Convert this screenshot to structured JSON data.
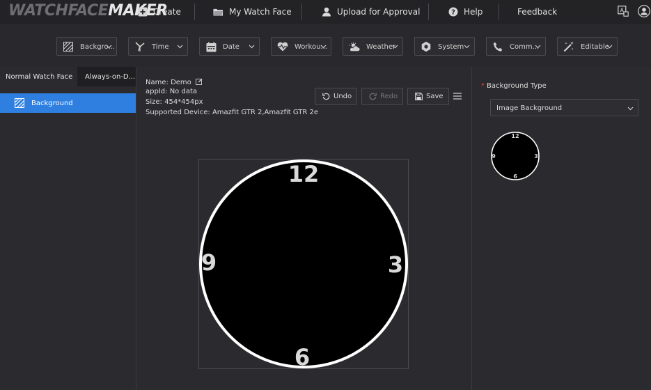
{
  "app": {
    "logo_part1": "WATCHFACE",
    "logo_part2": "MAKER"
  },
  "nav": {
    "create": "Create",
    "my_watch_face": "My Watch Face",
    "upload": "Upload for Approval",
    "help": "Help",
    "feedback": "Feedback"
  },
  "toolbar": {
    "items": [
      {
        "label": "Backgro...",
        "icon": "background-stripes-icon"
      },
      {
        "label": "Time",
        "icon": "windmill-icon"
      },
      {
        "label": "Date",
        "icon": "calendar-icon"
      },
      {
        "label": "Workou...",
        "icon": "heart-icon"
      },
      {
        "label": "Weather",
        "icon": "weather-icon"
      },
      {
        "label": "System",
        "icon": "hexagon-icon"
      },
      {
        "label": "Comm...",
        "icon": "phone-icon"
      },
      {
        "label": "Editable",
        "icon": "magic-wand-icon"
      }
    ]
  },
  "left": {
    "tab_normal": "Normal Watch Face",
    "tab_aod": "Always-on-D...",
    "layer": "Background"
  },
  "info": {
    "name_label": "Name:",
    "name_value": "Demo",
    "appid_label": "appId:",
    "appid_value": "No data",
    "size_label": "Size:",
    "size_value": "454*454px",
    "device_label": "Supported Device:",
    "device_value": "Amazfit GTR 2,Amazfit GTR 2e"
  },
  "actions": {
    "undo": "Undo",
    "redo": "Redo",
    "save": "Save"
  },
  "watch": {
    "n12": "12",
    "n3": "3",
    "n6": "6",
    "n9": "9"
  },
  "right": {
    "field_label": "Background Type",
    "select_value": "Image Background"
  },
  "colors": {
    "accent": "#2f7fe0",
    "required": "#e0453a"
  }
}
